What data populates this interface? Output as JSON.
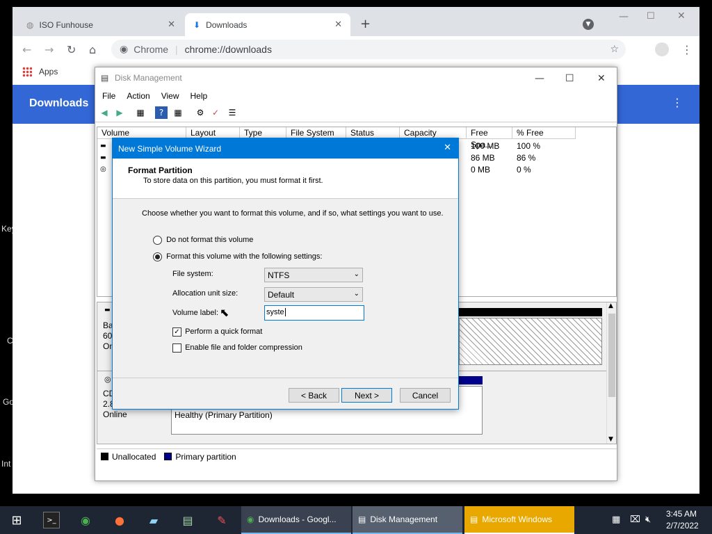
{
  "browser": {
    "tabs": [
      {
        "title": "ISO Funhouse"
      },
      {
        "title": "Downloads"
      }
    ],
    "new_tab": "+",
    "omnibox": {
      "scheme_label": "Chrome",
      "url": "chrome://downloads"
    },
    "bookmarks": {
      "apps": "Apps"
    },
    "page_title": "Downloads"
  },
  "left_fragments": [
    "Key",
    "C",
    "Go",
    "Int"
  ],
  "disk_mgmt": {
    "title": "Disk Management",
    "menu": [
      "File",
      "Action",
      "View",
      "Help"
    ],
    "columns": [
      "Volume",
      "Layout",
      "Type",
      "File System",
      "Status",
      "Capacity",
      "Free Spa...",
      "% Free"
    ],
    "rows": [
      {
        "free": "100 MB",
        "pct": "100 %"
      },
      {
        "free": "86 MB",
        "pct": "86 %"
      },
      {
        "free": "0 MB",
        "pct": "0 %"
      }
    ],
    "disk0": {
      "line1": "Ba",
      "line2": "60.",
      "line3": "On"
    },
    "cdrom": {
      "line1": "CD",
      "line2": "2.8",
      "line3": "Online",
      "partition_status": "Healthy (Primary Partition)"
    },
    "legend": {
      "unallocated": "Unallocated",
      "primary": "Primary partition"
    }
  },
  "wizard": {
    "title": "New Simple Volume Wizard",
    "heading": "Format Partition",
    "subheading": "To store data on this partition, you must format it first.",
    "prompt": "Choose whether you want to format this volume, and if so, what settings you want to use.",
    "opt_no_format": "Do not format this volume",
    "opt_format": "Format this volume with the following settings:",
    "fs_label": "File system:",
    "fs_value": "NTFS",
    "alloc_label": "Allocation unit size:",
    "alloc_value": "Default",
    "vol_label": "Volume label:",
    "vol_value": "syste",
    "quick_format": "Perform a quick format",
    "compression": "Enable file and folder compression",
    "back": "< Back",
    "next": "Next >",
    "cancel": "Cancel"
  },
  "taskbar": {
    "tasks": [
      "Downloads - Googl...",
      "Disk Management",
      "Microsoft Windows"
    ],
    "time": "3:45 AM",
    "date": "2/7/2022"
  },
  "colors": {
    "accent": "#0078d7",
    "chrome_header": "#3367d6",
    "ms_windows_task": "#e8a800"
  }
}
